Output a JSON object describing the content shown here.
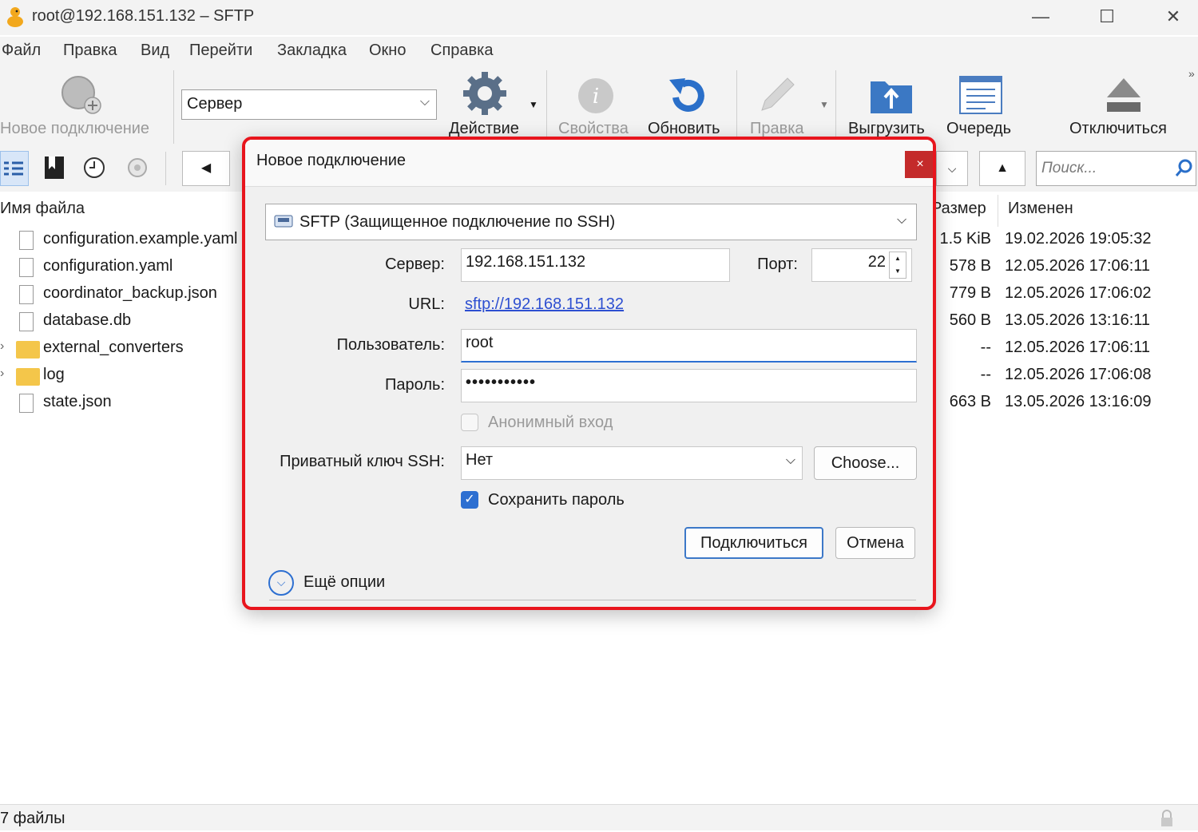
{
  "window": {
    "title": "root@192.168.151.132 – SFTP",
    "minimize": "—",
    "maximize": "☐",
    "close": "✕"
  },
  "menu": [
    "Файл",
    "Правка",
    "Вид",
    "Перейти",
    "Закладка",
    "Окно",
    "Справка"
  ],
  "toolbar": {
    "new_connection": "Новое подключение",
    "server_select": "Сервер",
    "action": "Действие",
    "properties": "Свойства",
    "refresh": "Обновить",
    "edit": "Правка",
    "upload": "Выгрузить",
    "queue": "Очередь",
    "disconnect": "Отключиться"
  },
  "search": {
    "placeholder": "Поиск..."
  },
  "file_list": {
    "headers": {
      "name": "Имя файла",
      "size": "Размер",
      "modified": "Изменен"
    },
    "rows": [
      {
        "name": "configuration.example.yaml",
        "size": "1.5 KiB",
        "modified": "19.02.2026 19:05:32",
        "kind": "file"
      },
      {
        "name": "configuration.yaml",
        "size": "578 B",
        "modified": "12.05.2026 17:06:11",
        "kind": "file"
      },
      {
        "name": "coordinator_backup.json",
        "size": "779 B",
        "modified": "12.05.2026 17:06:02",
        "kind": "file"
      },
      {
        "name": "database.db",
        "size": "560 B",
        "modified": "13.05.2026 13:16:11",
        "kind": "file"
      },
      {
        "name": "external_converters",
        "size": "--",
        "modified": "12.05.2026 17:06:11",
        "kind": "folder"
      },
      {
        "name": "log",
        "size": "--",
        "modified": "12.05.2026 17:06:08",
        "kind": "folder"
      },
      {
        "name": "state.json",
        "size": "663 B",
        "modified": "13.05.2026 13:16:09",
        "kind": "file"
      }
    ]
  },
  "status": {
    "text": "7 файлы"
  },
  "dialog": {
    "title": "Новое подключение",
    "close": "×",
    "protocol": "SFTP (Защищенное подключение по SSH)",
    "server_label": "Сервер:",
    "server_value": "192.168.151.132",
    "port_label": "Порт:",
    "port_value": "22",
    "url_label": "URL:",
    "url_value": "sftp://192.168.151.132",
    "user_label": "Пользователь:",
    "user_value": "root",
    "password_label": "Пароль:",
    "password_value": "•••••••••••",
    "anonymous_label": "Анонимный вход",
    "anonymous_checked": false,
    "ssh_key_label": "Приватный ключ SSH:",
    "ssh_key_value": "Нет",
    "choose_button": "Choose...",
    "save_password_label": "Сохранить пароль",
    "save_password_checked": true,
    "connect_button": "Подключиться",
    "cancel_button": "Отмена",
    "more_options": "Ещё опции"
  },
  "colors": {
    "highlight_border": "#e8151d",
    "accent": "#2d6fd1",
    "close_btn": "#c42b2b"
  }
}
